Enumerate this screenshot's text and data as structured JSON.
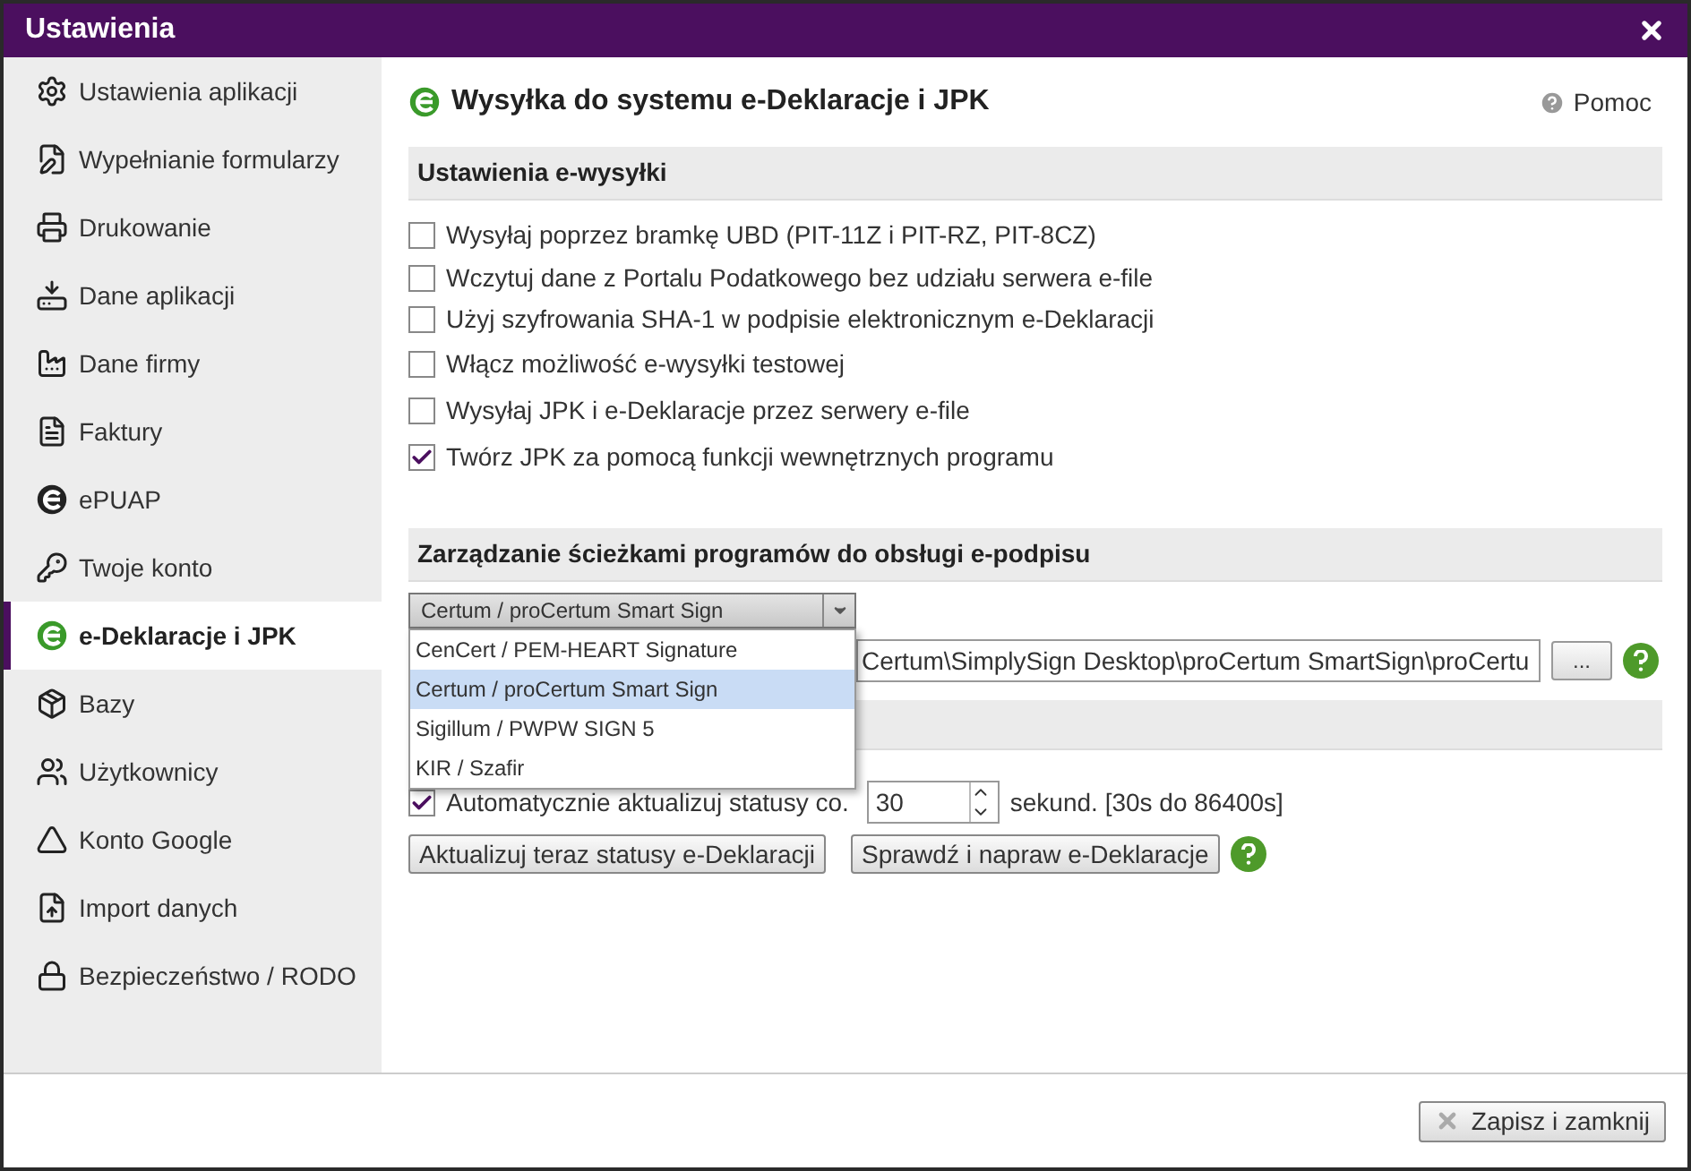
{
  "window": {
    "title": "Ustawienia"
  },
  "sidebar": {
    "items": [
      {
        "label": "Ustawienia aplikacji",
        "selected": false
      },
      {
        "label": "Wypełnianie formularzy",
        "selected": false
      },
      {
        "label": "Drukowanie",
        "selected": false
      },
      {
        "label": "Dane aplikacji",
        "selected": false
      },
      {
        "label": "Dane firmy",
        "selected": false
      },
      {
        "label": "Faktury",
        "selected": false
      },
      {
        "label": "ePUAP",
        "selected": false
      },
      {
        "label": "Twoje konto",
        "selected": false
      },
      {
        "label": "e-Deklaracje i JPK",
        "selected": true
      },
      {
        "label": "Bazy",
        "selected": false
      },
      {
        "label": "Użytkownicy",
        "selected": false
      },
      {
        "label": "Konto Google",
        "selected": false
      },
      {
        "label": "Import danych",
        "selected": false
      },
      {
        "label": "Bezpieczeństwo / RODO",
        "selected": false
      }
    ]
  },
  "page": {
    "title": "Wysyłka do systemu e-Deklaracje i JPK",
    "help": "Pomoc"
  },
  "e_sending": {
    "header": "Ustawienia e-wysyłki",
    "options": [
      {
        "label": "Wysyłaj poprzez bramkę UBD (PIT-11Z i PIT-RZ, PIT-8CZ)",
        "checked": false
      },
      {
        "label": "Wczytuj dane z Portalu Podatkowego bez udziału serwera e-file",
        "checked": false
      },
      {
        "label": "Użyj szyfrowania SHA-1 w podpisie elektronicznym e-Deklaracji",
        "checked": false
      },
      {
        "label": "Włącz możliwość e-wysyłki testowej",
        "checked": false
      },
      {
        "label": "Wysyłaj JPK i e-Deklaracje przez serwery e-file",
        "checked": false
      },
      {
        "label": "Twórz JPK za pomocą funkcji wewnętrznych programu",
        "checked": true
      }
    ]
  },
  "signature_paths": {
    "header": "Zarządzanie ścieżkami programów do obsługi e-podpisu",
    "program_select": {
      "value": "Certum / proCertum Smart Sign",
      "expanded": true,
      "options": [
        {
          "label": "CenCert / PEM-HEART Signature",
          "selected": false
        },
        {
          "label": "Certum / proCertum Smart Sign",
          "selected": true
        },
        {
          "label": "Sigillum / PWPW SIGN 5",
          "selected": false
        },
        {
          "label": "KIR / Szafir",
          "selected": false
        }
      ]
    },
    "path_field": {
      "value": "Certum\\SimplySign Desktop\\proCertum SmartSign\\proCertu",
      "browse": "..."
    }
  },
  "statuses": {
    "auto_update": {
      "label": "Automatycznie aktualizuj statusy co.",
      "checked": true
    },
    "interval": {
      "value": "30"
    },
    "unit_hint": "sekund. [30s do 86400s]",
    "buttons": [
      "Aktualizuj teraz statusy e-Deklaracji",
      "Sprawdź i napraw e-Deklaracje"
    ]
  },
  "footer": {
    "save_button": "Zapisz i zamknij"
  }
}
